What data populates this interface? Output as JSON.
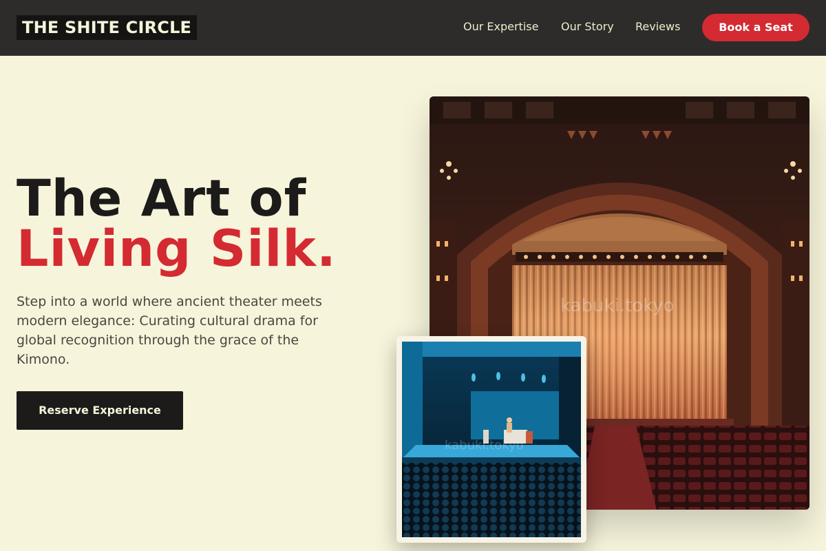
{
  "header": {
    "logo": "THE SHITE CIRCLE",
    "nav": [
      {
        "label": "Our Expertise"
      },
      {
        "label": "Our Story"
      },
      {
        "label": "Reviews"
      }
    ],
    "cta_label": "Book a Seat"
  },
  "hero": {
    "title_line1": "The Art of",
    "title_line2": "Living Silk.",
    "description": "Step into a world where ancient theater meets modern elegance: Curating cultural drama for global recognition through the grace of the Kimono.",
    "cta_label": "Reserve Experience"
  },
  "images": {
    "main_watermark": "kabuki.tokyo",
    "inset_watermark": "kabuki.tokyo"
  },
  "colors": {
    "page_bg": "#f6f4da",
    "header_bg": "#2e2c2a",
    "accent": "#d42a32",
    "dark": "#1c1b1a"
  }
}
